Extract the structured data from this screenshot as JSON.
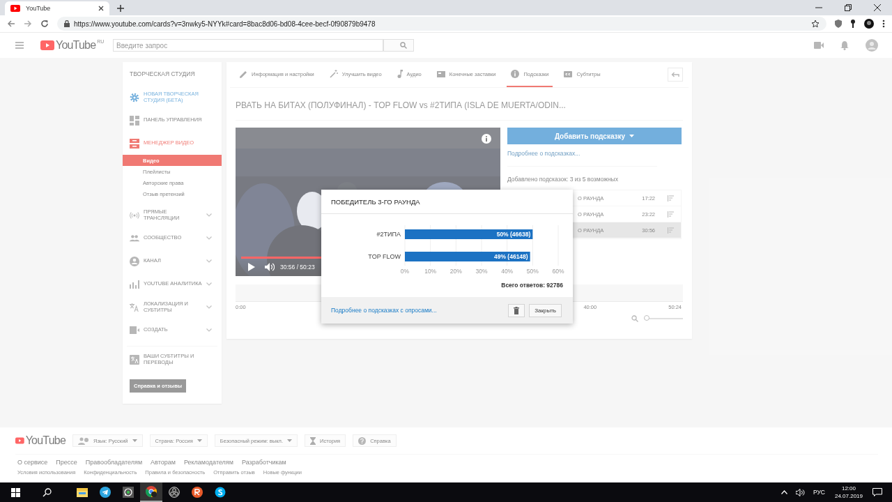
{
  "browser": {
    "tab_title": "YouTube",
    "url": "https://www.youtube.com/cards?v=3nwky5-NYYk#card=8bac8d06-bd08-4cee-becf-0f90879b9478"
  },
  "header": {
    "logo": "YouTube",
    "region": "RU",
    "search": {
      "placeholder": "Введите запрос"
    }
  },
  "sidebar": {
    "title": "ТВОРЧЕСКАЯ СТУДИЯ",
    "items": [
      {
        "label": "НОВАЯ ТВОРЧЕСКАЯ СТУДИЯ (БЕТА)",
        "kind": "beta",
        "selected": false
      },
      {
        "label": "ПАНЕЛЬ УПРАВЛЕНИЯ",
        "kind": "link",
        "selected": false
      },
      {
        "label": "МЕНЕДЖЕР ВИДЕО",
        "kind": "section",
        "selected": true,
        "expanded": true,
        "children": [
          {
            "label": "Видео",
            "selected": true
          },
          {
            "label": "Плейлисты",
            "selected": false
          },
          {
            "label": "Авторские права",
            "selected": false
          },
          {
            "label": "Отзыв претензий",
            "selected": false
          }
        ]
      },
      {
        "label": "ПРЯМЫЕ ТРАНСЛЯЦИИ",
        "kind": "section",
        "selected": false,
        "expanded": false
      },
      {
        "label": "СООБЩЕСТВО",
        "kind": "section",
        "selected": false,
        "expanded": false
      },
      {
        "label": "КАНАЛ",
        "kind": "section",
        "selected": false,
        "expanded": false
      },
      {
        "label": "YOUTUBE АНАЛИТИКА",
        "kind": "section",
        "selected": false,
        "expanded": false
      },
      {
        "label": "ЛОКАЛИЗАЦИЯ И СУБТИТРЫ",
        "kind": "section",
        "selected": false,
        "expanded": false
      },
      {
        "label": "СОЗДАТЬ",
        "kind": "section",
        "selected": false,
        "expanded": false
      },
      {
        "label": "ВАШИ СУБТИТРЫ И ПЕРЕВОДЫ",
        "kind": "link",
        "selected": false
      }
    ],
    "help_button": "Справка и отзывы"
  },
  "tabs": [
    {
      "label": "Информация и настройки",
      "selected": false
    },
    {
      "label": "Улучшить видео",
      "selected": false
    },
    {
      "label": "Аудио",
      "selected": false
    },
    {
      "label": "Конечные заставки",
      "selected": false
    },
    {
      "label": "Подсказки",
      "selected": true
    },
    {
      "label": "Субтитры",
      "selected": false
    }
  ],
  "video": {
    "title": "РВАТЬ НА БИТАХ (ПОЛУФИНАЛ) - TOP FLOW vs #2ТИПА (ISLA DE MUERTA/ODIN...",
    "kind": "picture",
    "time": "30:56 / 50:23",
    "level": 0.61
  },
  "cards": {
    "add_button": "Добавить подсказку",
    "help_link": "Подробнее о подсказках...",
    "count": "Добавлено подсказок: 3 из 5 возможных",
    "items": [
      {
        "title": "О РАУНДА",
        "time": "17:22",
        "selected": false
      },
      {
        "title": "О РАУНДА",
        "time": "23:22",
        "selected": false
      },
      {
        "title": "О РАУНДА",
        "time": "30:56",
        "selected": true
      }
    ]
  },
  "timeline": {
    "labels": [
      "0:00",
      "40:00",
      "50:24"
    ],
    "zoom": {
      "level": 0
    }
  },
  "dialog": {
    "title": "ПОБЕДИТЕЛЬ 3-ГО РАУНДА",
    "chart_data": {
      "type": "bar",
      "orientation": "horizontal",
      "grid": true,
      "categories": [
        "#2ТИПА",
        "TOP FLOW"
      ],
      "values": [
        50,
        49
      ],
      "value_labels": [
        "50% (46638)",
        "49% (46148)"
      ],
      "xlim": [
        0,
        60
      ],
      "xticks": [
        {
          "value": 0,
          "label": "0%"
        },
        {
          "value": 10,
          "label": "10%"
        },
        {
          "value": 20,
          "label": "20%"
        },
        {
          "value": 30,
          "label": "30%"
        },
        {
          "value": 40,
          "label": "40%"
        },
        {
          "value": 50,
          "label": "50%"
        },
        {
          "value": 60,
          "label": "60%"
        }
      ]
    },
    "total": "Всего ответов: 92786",
    "help_link": "Подробнее о подсказках с опросами...",
    "close_button": "Закрыть"
  },
  "footer": {
    "logo": "YouTube",
    "pickers": [
      "Язык: Русский",
      "Страна: Россия",
      "Безопасный режим: выкл."
    ],
    "buttons": [
      "История",
      "Справка"
    ],
    "links": [
      "О сервисе",
      "Прессе",
      "Правообладателям",
      "Авторам",
      "Рекламодателям",
      "Разработчикам"
    ],
    "small_links": [
      "Условия использования",
      "Конфиденциальность",
      "Правила и безопасность",
      "Отправить отзыв",
      "Новые функции"
    ]
  },
  "taskbar": {
    "apps": [
      {
        "selected": false
      },
      {
        "selected": false
      },
      {
        "selected": false
      },
      {
        "selected": true
      },
      {
        "selected": false
      },
      {
        "selected": false
      },
      {
        "selected": false
      }
    ],
    "language": "РУС",
    "time": "12:00",
    "date": "24.07.2019"
  }
}
